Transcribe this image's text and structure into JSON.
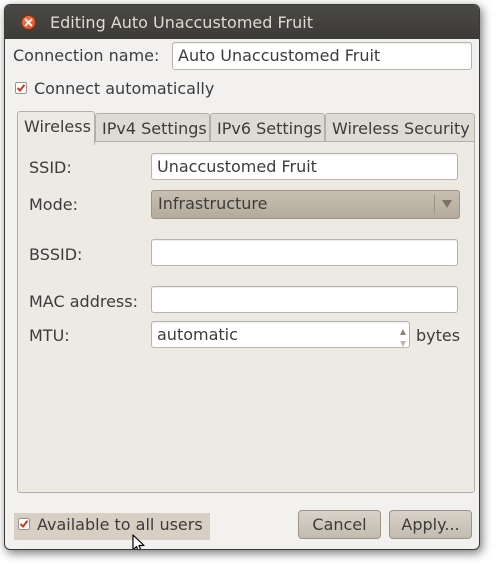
{
  "window": {
    "title": "Editing Auto Unaccustomed Fruit"
  },
  "connection": {
    "name_label": "Connection name:",
    "name_value": "Auto Unaccustomed Fruit",
    "connect_auto_label": "Connect automatically",
    "connect_auto_checked": true
  },
  "tabs": [
    {
      "label": "Wireless",
      "active": true
    },
    {
      "label": "IPv4 Settings",
      "active": false
    },
    {
      "label": "IPv6 Settings",
      "active": false
    },
    {
      "label": "Wireless Security",
      "active": false
    }
  ],
  "wireless": {
    "ssid_label": "SSID:",
    "ssid_value": "Unaccustomed Fruit",
    "mode_label": "Mode:",
    "mode_value": "Infrastructure",
    "bssid_label": "BSSID:",
    "bssid_value": "",
    "mac_label": "MAC address:",
    "mac_value": "",
    "mtu_label": "MTU:",
    "mtu_value": "automatic",
    "mtu_unit": "bytes"
  },
  "footer": {
    "available_label": "Available to all users",
    "available_checked": true,
    "cancel_label": "Cancel",
    "apply_label": "Apply..."
  },
  "icons": {
    "close": "close-icon",
    "check": "checkmark-icon",
    "combo_arrow": "triangle-down-icon",
    "spin": "spin-arrows-icon",
    "cursor": "mouse-pointer-icon"
  },
  "colors": {
    "titlebar": "#3c3b37",
    "close_button": "#e3552a",
    "check_mark": "#c8391b",
    "dialog_bg": "#f2f1f0"
  }
}
